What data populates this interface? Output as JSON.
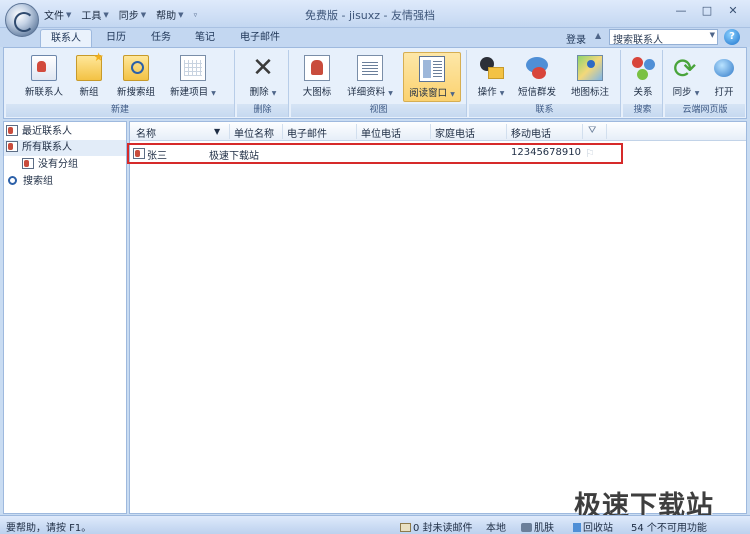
{
  "titlebar": {
    "menus": [
      "文件",
      "工具",
      "同步",
      "帮助"
    ],
    "title": "免费版 - jisuxz - 友情强档",
    "controls": [
      "—",
      "□",
      "✕"
    ]
  },
  "tabs": [
    "联系人",
    "日历",
    "任务",
    "笔记",
    "电子邮件"
  ],
  "header_right": {
    "login": "登录",
    "search_value": "搜索联系人",
    "help": "?"
  },
  "ribbon": {
    "groups": {
      "new": "新建",
      "delete": "删除",
      "view": "视图",
      "contact": "联系",
      "search": "搜索",
      "cloud": "云端网页版"
    },
    "buttons": {
      "new_contact": "新联系人",
      "new_group": "新组",
      "new_search_group": "新搜索组",
      "new_item": "新建项目",
      "delete": "删除",
      "large_icons": "大图标",
      "detailed_info": "详细资料",
      "reading_window": "阅读窗口",
      "operation": "操作",
      "sms_bulk": "短信群发",
      "map_label": "地图标注",
      "relation": "关系",
      "sync": "同步",
      "open": "打开"
    }
  },
  "nav": {
    "items": [
      "最近联系人",
      "所有联系人",
      "没有分组",
      "搜索组"
    ]
  },
  "list": {
    "columns": [
      "名称",
      "单位名称",
      "电子邮件",
      "单位电话",
      "家庭电话",
      "移动电话"
    ],
    "rows": [
      {
        "name": "张三",
        "company": "极速下载站",
        "email": "",
        "work_phone": "",
        "home_phone": "",
        "mobile": "12345678910"
      }
    ]
  },
  "watermark": "极速下载站",
  "status": {
    "help": "要帮助，请按 F1。",
    "unread": "0 封未读邮件",
    "local": "本地",
    "skin": "肌肤",
    "recycle": "回收站",
    "unavailable": "54 个不可用功能"
  },
  "colors": {
    "accent": "#c3d7f1",
    "highlight_border": "#d62a2a"
  }
}
